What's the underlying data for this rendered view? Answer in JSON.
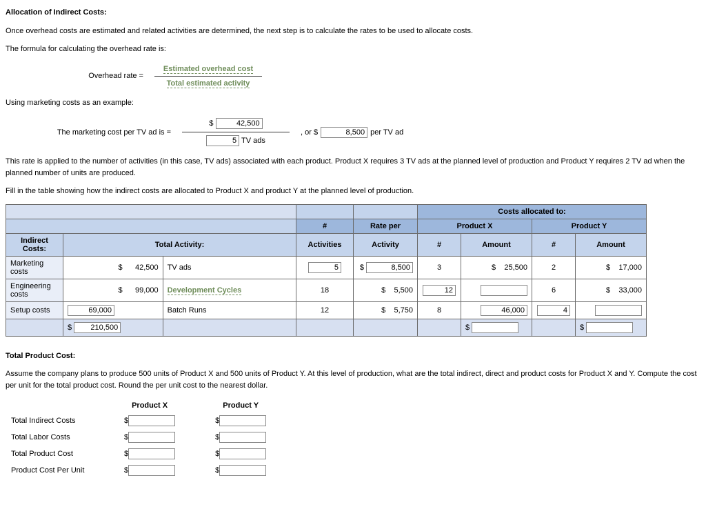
{
  "heading1": "Allocation of Indirect Costs:",
  "intro1": "Once overhead costs are estimated and related activities are determined, the next step is to calculate the rates to be used to allocate costs.",
  "intro2": "The formula for calculating the overhead rate is:",
  "formula": {
    "lhs": "Overhead rate =",
    "numerator": "Estimated overhead cost",
    "denominator": "Total estimated activity"
  },
  "example_lead": "Using marketing costs as an example:",
  "example": {
    "lhs": "The marketing cost per TV ad is =",
    "num_prefix": "$",
    "num_value": "42,500",
    "den_value": "5",
    "den_suffix": "TV ads",
    "or_label": ", or $",
    "rate_value": "8,500",
    "rate_suffix": "per TV ad"
  },
  "para3": "This rate is applied to the number of activities (in this case, TV ads) associated with each product. Product X requires 3 TV ads at the planned level of production and Product Y requires 2 TV ad when the planned number of units are produced.",
  "para4": "Fill in the table showing how the indirect costs are allocated to Product X and product Y at the planned level of production.",
  "table": {
    "costs_allocated_to": "Costs allocated to:",
    "hash": "#",
    "rate_per": "Rate per",
    "product_x": "Product X",
    "product_y": "Product Y",
    "indirect_costs": "Indirect Costs:",
    "total_activity": "Total Activity:",
    "activities": "Activities",
    "activity": "Activity",
    "amount": "Amount",
    "rows": [
      {
        "label": "Marketing costs",
        "amt": "42,500",
        "act_label": "TV ads",
        "act_is_link": false,
        "n_act": "5",
        "n_act_input": true,
        "rate": "8,500",
        "rate_input": true,
        "x_n": "3",
        "x_n_input": false,
        "x_amt": "25,500",
        "x_amt_input": false,
        "y_n": "2",
        "y_n_input": false,
        "y_amt": "17,000",
        "y_amt_input": false
      },
      {
        "label": "Engineering costs",
        "amt": "99,000",
        "act_label": "Development Cycles",
        "act_is_link": true,
        "n_act": "18",
        "n_act_input": false,
        "rate": "5,500",
        "rate_input": false,
        "x_n": "12",
        "x_n_input": true,
        "x_amt": "",
        "x_amt_input": true,
        "y_n": "6",
        "y_n_input": false,
        "y_amt": "33,000",
        "y_amt_input": false
      },
      {
        "label": "Setup costs",
        "amt": "69,000",
        "amt_input": true,
        "act_label": "Batch Runs",
        "act_is_link": false,
        "n_act": "12",
        "n_act_input": false,
        "rate": "5,750",
        "rate_input": false,
        "x_n": "8",
        "x_n_input": false,
        "x_amt": "46,000",
        "x_amt_input": true,
        "y_n": "4",
        "y_n_input": true,
        "y_amt": "",
        "y_amt_input": true
      }
    ],
    "footer_total": "210,500"
  },
  "heading2": "Total Product Cost:",
  "para5": "Assume the company plans to produce 500 units of Product X and 500 units of Product Y. At this level of production, what are the total indirect, direct and product costs for Product X and Y. Compute the cost per unit for the total product cost. Round the per unit cost to the nearest dollar.",
  "totals": {
    "col_x": "Product X",
    "col_y": "Product Y",
    "rows": [
      "Total Indirect Costs",
      "Total Labor Costs",
      "Total Product Cost",
      "Product Cost Per Unit"
    ]
  },
  "dollar": "$"
}
